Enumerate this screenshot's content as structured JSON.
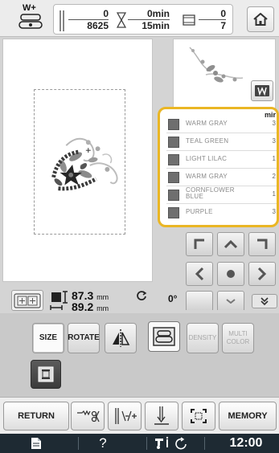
{
  "status": {
    "presser_foot_label": "W+",
    "stitch_count": "0",
    "stitch_total": "8625",
    "time_elapsed": "0min",
    "time_total": "15min",
    "color_current": "0",
    "color_total": "7"
  },
  "color_list": {
    "mini_label": "mir",
    "items": [
      {
        "name": "WARM GRAY",
        "minutes": "3"
      },
      {
        "name": "TEAL GREEN",
        "minutes": "3"
      },
      {
        "name": "LIGHT LILAC",
        "minutes": "1"
      },
      {
        "name": "WARM GRAY",
        "minutes": "2"
      },
      {
        "name": "CORNFLOWER BLUE",
        "minutes": "1"
      },
      {
        "name": "PURPLE",
        "minutes": "3"
      }
    ]
  },
  "pattern_info": {
    "height": "87.3",
    "width": "89.2",
    "unit": "mm",
    "angle": "0°"
  },
  "edit_buttons": {
    "size": "SIZE",
    "rotate": "ROTATE",
    "density": "DENSITY",
    "multi_color": "MULTI COLOR"
  },
  "action_bar": {
    "return": "RETURN",
    "memory": "MEMORY"
  },
  "system": {
    "help": "?",
    "clock": "12:00"
  },
  "colors": {
    "accent_outline": "#eab624",
    "stitch_dark": "#2b2b2b",
    "stitch_mid": "#7a7a7a",
    "stitch_light": "#b5b5b5"
  }
}
